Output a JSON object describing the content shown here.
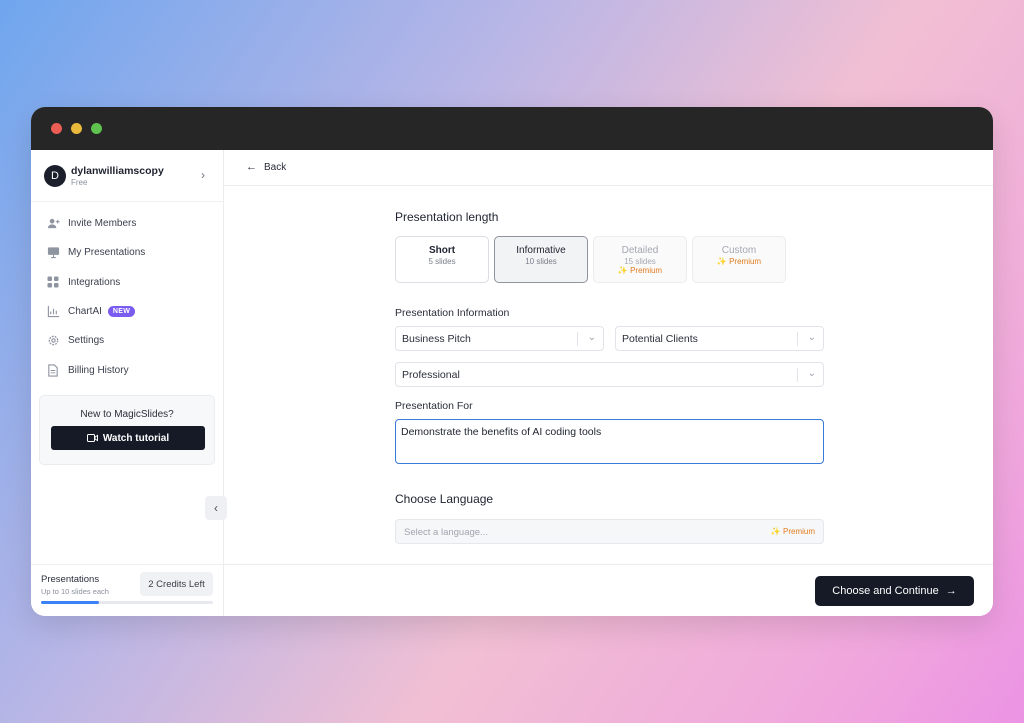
{
  "user": {
    "initial": "D",
    "name": "dylanwilliamscopy",
    "plan": "Free"
  },
  "sidebar": {
    "items": [
      {
        "label": "Invite Members",
        "icon": "user-plus-icon"
      },
      {
        "label": "My Presentations",
        "icon": "presentation-icon"
      },
      {
        "label": "Integrations",
        "icon": "grid-icon"
      },
      {
        "label": "ChartAI",
        "icon": "chart-icon",
        "badge": "NEW"
      },
      {
        "label": "Settings",
        "icon": "gear-icon"
      },
      {
        "label": "Billing History",
        "icon": "document-icon"
      }
    ],
    "tutorial": {
      "title": "New to MagicSlides?",
      "button": "Watch tutorial"
    },
    "footer": {
      "title": "Presentations",
      "subtitle": "Up to 10 slides each",
      "credits": "2 Credits Left",
      "usage_fraction": 0.34
    }
  },
  "main": {
    "back_label": "Back",
    "length": {
      "title": "Presentation length",
      "options": [
        {
          "name": "Short",
          "slides": "5 slides",
          "premium": ""
        },
        {
          "name": "Informative",
          "slides": "10 slides",
          "premium": ""
        },
        {
          "name": "Detailed",
          "slides": "15 slides",
          "premium": "✨ Premium"
        },
        {
          "name": "Custom",
          "slides": "",
          "premium": "✨ Premium"
        }
      ],
      "selected": "Informative"
    },
    "info": {
      "title": "Presentation Information",
      "type": "Business Pitch",
      "audience": "Potential Clients",
      "tone": "Professional"
    },
    "for": {
      "title": "Presentation For",
      "value": "Demonstrate the benefits of AI coding tools"
    },
    "language": {
      "title": "Choose Language",
      "placeholder": "Select a language...",
      "premium": "✨ Premium"
    },
    "continue_label": "Choose and Continue"
  }
}
